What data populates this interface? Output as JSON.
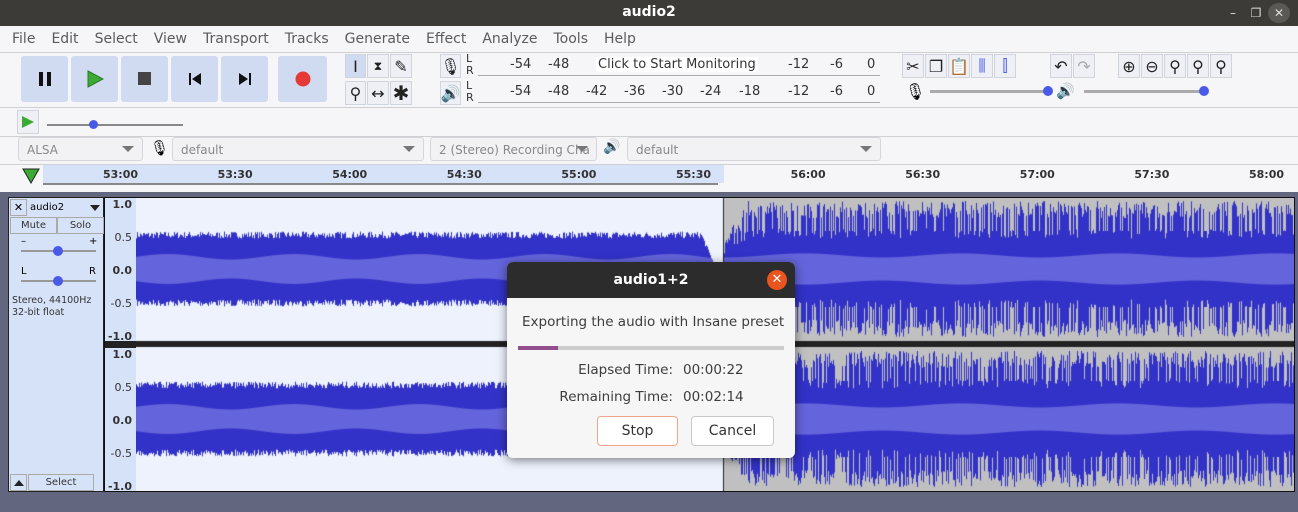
{
  "window": {
    "title": "audio2",
    "minimize": "–",
    "maximize": "❐",
    "close": "✕"
  },
  "menu": [
    "File",
    "Edit",
    "Select",
    "View",
    "Transport",
    "Tracks",
    "Generate",
    "Effect",
    "Analyze",
    "Tools",
    "Help"
  ],
  "meter": {
    "record_ticks": [
      "-54",
      "-48"
    ],
    "record_prompt": "Click to Start Monitoring",
    "record_ticks_right": [
      "-12",
      "-6",
      "0"
    ],
    "play_ticks": [
      "-54",
      "-48",
      "-42",
      "-36",
      "-30",
      "-24",
      "-18",
      "-12",
      "-6",
      "0"
    ],
    "L": "L",
    "R": "R"
  },
  "device": {
    "host": "ALSA",
    "input": "default",
    "channels": "2 (Stereo) Recording Cha",
    "output": "default"
  },
  "timeline": [
    "53:00",
    "53:30",
    "54:00",
    "54:30",
    "55:00",
    "55:30",
    "56:00",
    "56:30",
    "57:00",
    "57:30",
    "58:00"
  ],
  "track": {
    "name": "audio2",
    "mute": "Mute",
    "solo": "Solo",
    "gain_minus": "–",
    "gain_plus": "+",
    "pan_left": "L",
    "pan_right": "R",
    "info1": "Stereo, 44100Hz",
    "info2": "32-bit float",
    "select": "Select",
    "gain": 0.5,
    "pan": 0.5
  },
  "vruler": [
    "1.0",
    "0.5",
    "0.0",
    "-0.5",
    "-1.0"
  ],
  "sliders": {
    "play_speed": 0.35,
    "rec_volume": 1.0,
    "play_volume": 1.0
  },
  "dialog": {
    "title": "audio1+2",
    "message": "Exporting the audio with Insane preset",
    "progress": 0.15,
    "elapsed_label": "Elapsed Time:",
    "elapsed": "00:00:22",
    "remaining_label": "Remaining Time:",
    "remaining": "00:02:14",
    "stop": "Stop",
    "cancel": "Cancel"
  },
  "colors": {
    "wave": "#3232c8",
    "wave_rms": "#6464dc",
    "selected_bg": "#eef2fc",
    "unselected_bg": "#c0c0c0",
    "progress": "#924d8b",
    "record": "#e53935",
    "play": "#3aaa35"
  }
}
